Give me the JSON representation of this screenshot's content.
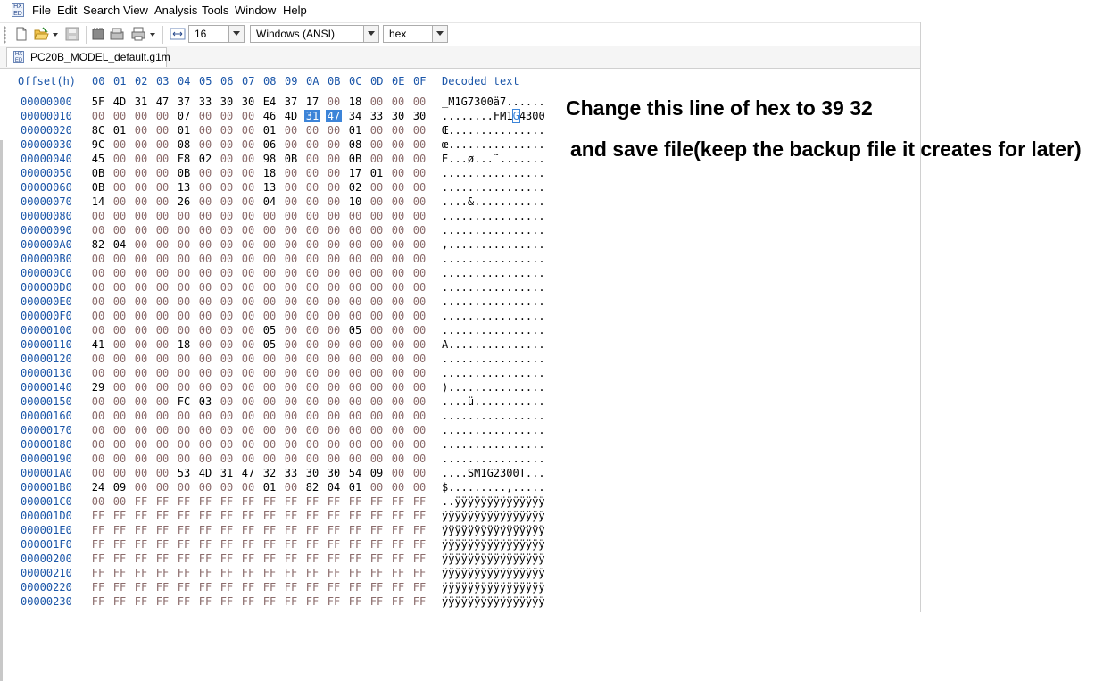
{
  "menubar": {
    "items": [
      "File",
      "Edit",
      "Search",
      "View",
      "Analysis",
      "Tools",
      "Window",
      "Help"
    ]
  },
  "toolbar": {
    "bytes_per_row": "16",
    "encoding": "Windows (ANSI)",
    "display_mode": "hex"
  },
  "tab": {
    "label": "PC20B_MODEL_default.g1m"
  },
  "hexview": {
    "offset_header": "Offset(h)",
    "columns": [
      "00",
      "01",
      "02",
      "03",
      "04",
      "05",
      "06",
      "07",
      "08",
      "09",
      "0A",
      "0B",
      "0C",
      "0D",
      "0E",
      "0F"
    ],
    "decoded_header": "Decoded text",
    "selection": {
      "row": 1,
      "bytes": [
        10,
        11
      ],
      "cursor_byte": 11
    },
    "rows": [
      {
        "offset": "00000000",
        "bytes": "5F 4D 31 47 37 33 30 30 E4 37 17 00 18 00 00 00",
        "decoded": "_M1G7300ä7......"
      },
      {
        "offset": "00000010",
        "bytes": "00 00 00 00 07 00 00 00 46 4D 31 47 34 33 30 30",
        "decoded": "........FM1G4300"
      },
      {
        "offset": "00000020",
        "bytes": "8C 01 00 00 01 00 00 00 01 00 00 00 01 00 00 00",
        "decoded": "Œ..............."
      },
      {
        "offset": "00000030",
        "bytes": "9C 00 00 00 08 00 00 00 06 00 00 00 08 00 00 00",
        "decoded": "œ..............."
      },
      {
        "offset": "00000040",
        "bytes": "45 00 00 00 F8 02 00 00 98 0B 00 00 0B 00 00 00",
        "decoded": "E...ø...˜......."
      },
      {
        "offset": "00000050",
        "bytes": "0B 00 00 00 0B 00 00 00 18 00 00 00 17 01 00 00",
        "decoded": "................"
      },
      {
        "offset": "00000060",
        "bytes": "0B 00 00 00 13 00 00 00 13 00 00 00 02 00 00 00",
        "decoded": "................"
      },
      {
        "offset": "00000070",
        "bytes": "14 00 00 00 26 00 00 00 04 00 00 00 10 00 00 00",
        "decoded": "....&..........."
      },
      {
        "offset": "00000080",
        "bytes": "00 00 00 00 00 00 00 00 00 00 00 00 00 00 00 00",
        "decoded": "................"
      },
      {
        "offset": "00000090",
        "bytes": "00 00 00 00 00 00 00 00 00 00 00 00 00 00 00 00",
        "decoded": "................"
      },
      {
        "offset": "000000A0",
        "bytes": "82 04 00 00 00 00 00 00 00 00 00 00 00 00 00 00",
        "decoded": "‚..............."
      },
      {
        "offset": "000000B0",
        "bytes": "00 00 00 00 00 00 00 00 00 00 00 00 00 00 00 00",
        "decoded": "................"
      },
      {
        "offset": "000000C0",
        "bytes": "00 00 00 00 00 00 00 00 00 00 00 00 00 00 00 00",
        "decoded": "................"
      },
      {
        "offset": "000000D0",
        "bytes": "00 00 00 00 00 00 00 00 00 00 00 00 00 00 00 00",
        "decoded": "................"
      },
      {
        "offset": "000000E0",
        "bytes": "00 00 00 00 00 00 00 00 00 00 00 00 00 00 00 00",
        "decoded": "................"
      },
      {
        "offset": "000000F0",
        "bytes": "00 00 00 00 00 00 00 00 00 00 00 00 00 00 00 00",
        "decoded": "................"
      },
      {
        "offset": "00000100",
        "bytes": "00 00 00 00 00 00 00 00 05 00 00 00 05 00 00 00",
        "decoded": "................"
      },
      {
        "offset": "00000110",
        "bytes": "41 00 00 00 18 00 00 00 05 00 00 00 00 00 00 00",
        "decoded": "A..............."
      },
      {
        "offset": "00000120",
        "bytes": "00 00 00 00 00 00 00 00 00 00 00 00 00 00 00 00",
        "decoded": "................"
      },
      {
        "offset": "00000130",
        "bytes": "00 00 00 00 00 00 00 00 00 00 00 00 00 00 00 00",
        "decoded": "................"
      },
      {
        "offset": "00000140",
        "bytes": "29 00 00 00 00 00 00 00 00 00 00 00 00 00 00 00",
        "decoded": ")..............."
      },
      {
        "offset": "00000150",
        "bytes": "00 00 00 00 FC 03 00 00 00 00 00 00 00 00 00 00",
        "decoded": "....ü..........."
      },
      {
        "offset": "00000160",
        "bytes": "00 00 00 00 00 00 00 00 00 00 00 00 00 00 00 00",
        "decoded": "................"
      },
      {
        "offset": "00000170",
        "bytes": "00 00 00 00 00 00 00 00 00 00 00 00 00 00 00 00",
        "decoded": "................"
      },
      {
        "offset": "00000180",
        "bytes": "00 00 00 00 00 00 00 00 00 00 00 00 00 00 00 00",
        "decoded": "................"
      },
      {
        "offset": "00000190",
        "bytes": "00 00 00 00 00 00 00 00 00 00 00 00 00 00 00 00",
        "decoded": "................"
      },
      {
        "offset": "000001A0",
        "bytes": "00 00 00 00 53 4D 31 47 32 33 30 30 54 09 00 00",
        "decoded": "....SM1G2300T..."
      },
      {
        "offset": "000001B0",
        "bytes": "24 09 00 00 00 00 00 00 01 00 82 04 01 00 00 00",
        "decoded": "$.........‚....."
      },
      {
        "offset": "000001C0",
        "bytes": "00 00 FF FF FF FF FF FF FF FF FF FF FF FF FF FF",
        "decoded": "..ÿÿÿÿÿÿÿÿÿÿÿÿÿÿ"
      },
      {
        "offset": "000001D0",
        "bytes": "FF FF FF FF FF FF FF FF FF FF FF FF FF FF FF FF",
        "decoded": "ÿÿÿÿÿÿÿÿÿÿÿÿÿÿÿÿ"
      },
      {
        "offset": "000001E0",
        "bytes": "FF FF FF FF FF FF FF FF FF FF FF FF FF FF FF FF",
        "decoded": "ÿÿÿÿÿÿÿÿÿÿÿÿÿÿÿÿ"
      },
      {
        "offset": "000001F0",
        "bytes": "FF FF FF FF FF FF FF FF FF FF FF FF FF FF FF FF",
        "decoded": "ÿÿÿÿÿÿÿÿÿÿÿÿÿÿÿÿ"
      },
      {
        "offset": "00000200",
        "bytes": "FF FF FF FF FF FF FF FF FF FF FF FF FF FF FF FF",
        "decoded": "ÿÿÿÿÿÿÿÿÿÿÿÿÿÿÿÿ"
      },
      {
        "offset": "00000210",
        "bytes": "FF FF FF FF FF FF FF FF FF FF FF FF FF FF FF FF",
        "decoded": "ÿÿÿÿÿÿÿÿÿÿÿÿÿÿÿÿ"
      },
      {
        "offset": "00000220",
        "bytes": "FF FF FF FF FF FF FF FF FF FF FF FF FF FF FF FF",
        "decoded": "ÿÿÿÿÿÿÿÿÿÿÿÿÿÿÿÿ"
      },
      {
        "offset": "00000230",
        "bytes": "FF FF FF FF FF FF FF FF FF FF FF FF FF FF FF FF",
        "decoded": "ÿÿÿÿÿÿÿÿÿÿÿÿÿÿÿÿ"
      }
    ]
  },
  "annotation": {
    "line1": "Change this line of hex to 39 32",
    "line2": "and save file(keep the backup file it creates for later)"
  },
  "colors": {
    "offset_blue": "#1a55a8",
    "selection_blue": "#3c84d8",
    "zero_byte": "#8a6a6a"
  },
  "icons": [
    "new-file-icon",
    "open-folder-icon",
    "dropdown-arrow-icon",
    "save-icon",
    "ram-icon",
    "disk-icon",
    "print-icon",
    "bytes-per-row-icon"
  ]
}
